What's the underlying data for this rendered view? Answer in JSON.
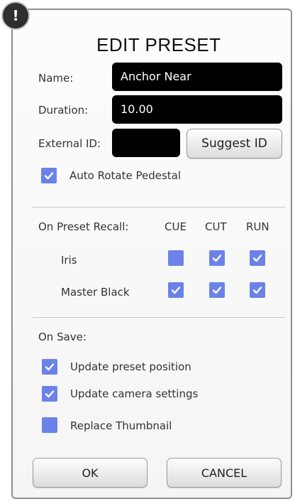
{
  "dialog": {
    "title": "EDIT PRESET",
    "alert_icon": "!"
  },
  "fields": {
    "name_label": "Name:",
    "name_value": "Anchor Near",
    "duration_label": "Duration:",
    "duration_value": "10.00",
    "external_id_label": "External ID:",
    "external_id_value": "",
    "suggest_id_label": "Suggest ID"
  },
  "auto_rotate": {
    "label": "Auto Rotate Pedestal",
    "checked": true
  },
  "recall": {
    "heading": "On Preset Recall:",
    "columns": [
      "CUE",
      "CUT",
      "RUN"
    ],
    "rows": [
      {
        "label": "Iris",
        "cue": false,
        "cut": true,
        "run": true
      },
      {
        "label": "Master Black",
        "cue": true,
        "cut": true,
        "run": true
      }
    ]
  },
  "on_save": {
    "heading": "On Save:",
    "items": [
      {
        "label": "Update preset position",
        "checked": true
      },
      {
        "label": "Update camera settings",
        "checked": true
      },
      {
        "label": "Replace Thumbnail",
        "checked": false
      }
    ]
  },
  "actions": {
    "ok_label": "OK",
    "cancel_label": "CANCEL"
  },
  "colors": {
    "checkbox": "#6b82e8",
    "field_bg": "#000000"
  }
}
